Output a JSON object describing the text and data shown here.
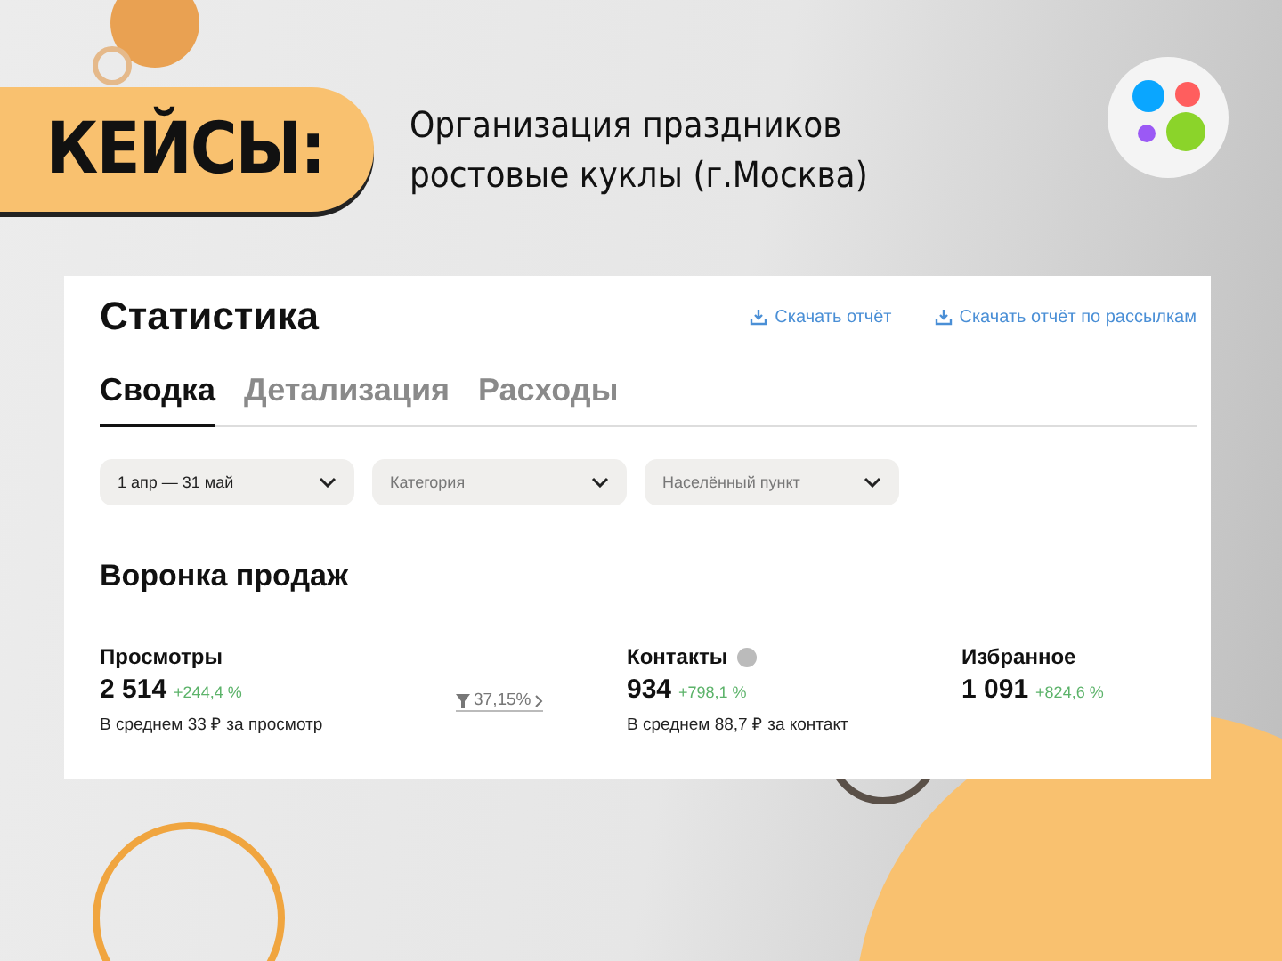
{
  "header": {
    "badge": "КЕЙСЫ:",
    "subtitle_lines": [
      "Организация праздников",
      "ростовые куклы (г.Москва)"
    ]
  },
  "stats": {
    "title": "Статистика",
    "links": [
      "Скачать отчёт",
      "Скачать отчёт по рассылкам"
    ],
    "tabs": [
      {
        "label": "Сводка",
        "selected": true
      },
      {
        "label": "Детализация",
        "selected": false
      },
      {
        "label": "Расходы",
        "selected": false
      }
    ],
    "filters": [
      {
        "value": "1 апр — 31 май"
      },
      {
        "placeholder": "Категория"
      },
      {
        "placeholder": "Населённый пункт"
      }
    ],
    "funnel": {
      "title": "Воронка продаж",
      "metrics": [
        {
          "label": "Просмотры",
          "value": "2 514",
          "change": "+244,4 %",
          "note": "В среднем 33 ₽ за просмотр",
          "conversion": "37,15%"
        },
        {
          "label": "Контакты",
          "value": "934",
          "change": "+798,1 %",
          "note": "В среднем 88,7 ₽ за контакт",
          "help": true
        },
        {
          "label": "Избранное",
          "value": "1 091",
          "change": "+824,6 %"
        }
      ]
    }
  }
}
